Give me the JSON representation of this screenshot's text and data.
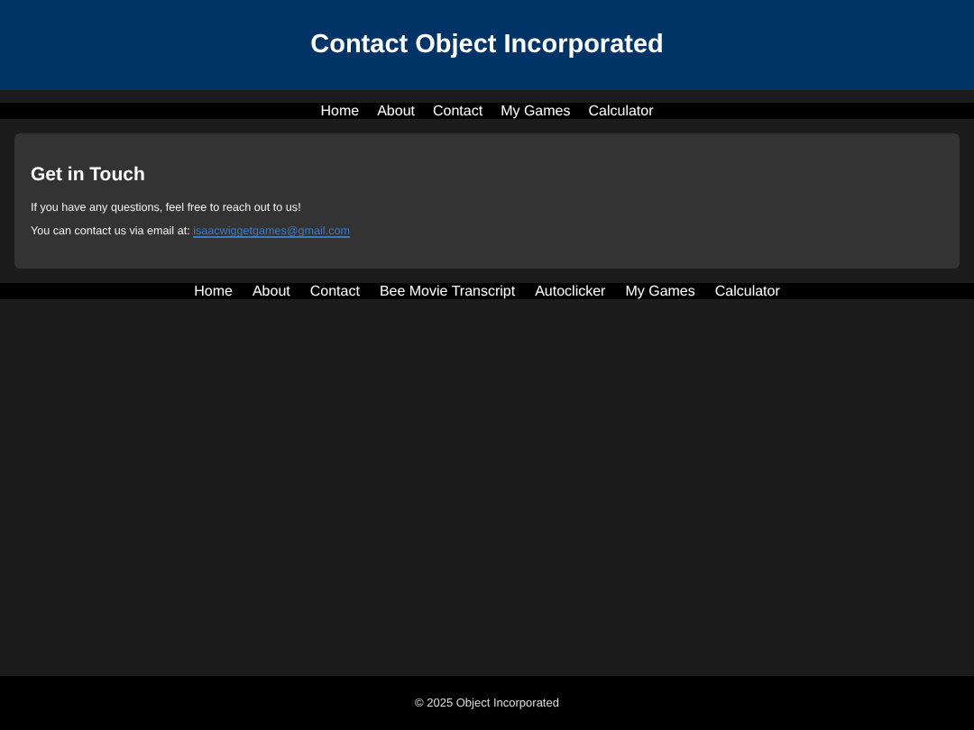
{
  "header": {
    "title": "Contact Object Incorporated"
  },
  "top_nav": [
    "Home",
    "About",
    "Contact",
    "My Games",
    "Calculator"
  ],
  "card": {
    "heading": "Get in Touch",
    "text": "If you have any questions, feel free to reach out to us!",
    "email_label": "You can contact us via email at:",
    "email": "isaacwiggetgames@gmail.com"
  },
  "bottom_nav": [
    "Home",
    "About",
    "Contact",
    "Bee Movie Transcript",
    "Autoclicker",
    "My Games",
    "Calculator"
  ],
  "footer": "© 2025 Object Incorporated"
}
